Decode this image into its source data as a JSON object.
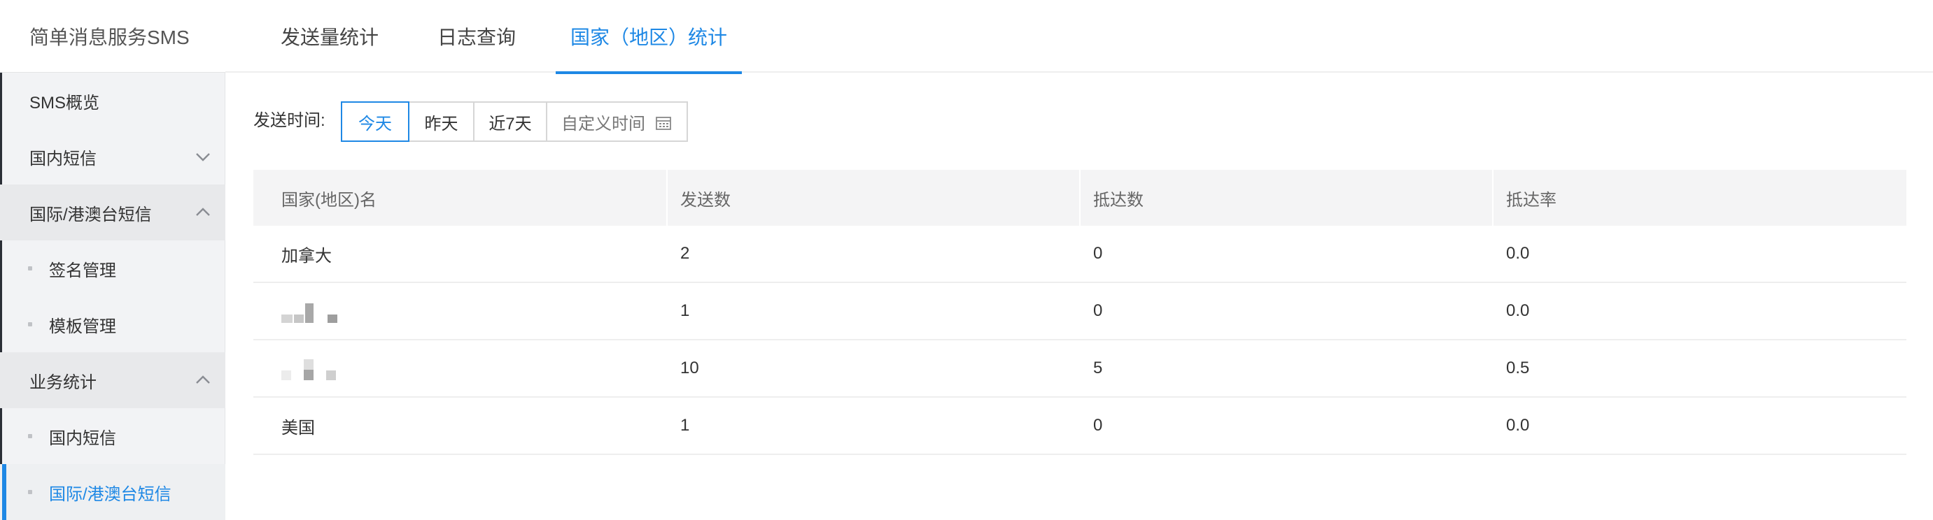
{
  "sidebar": {
    "title": "简单消息服务SMS",
    "items": [
      {
        "label": "SMS概览"
      },
      {
        "label": "国内短信",
        "chevron": "chevron-down-icon"
      },
      {
        "label": "国际/港澳台短信",
        "chevron": "chevron-up-icon"
      },
      {
        "label": "签名管理"
      },
      {
        "label": "模板管理"
      },
      {
        "label": "业务统计",
        "chevron": "chevron-up-icon"
      },
      {
        "label": "国内短信"
      },
      {
        "label": "国际/港澳台短信"
      }
    ]
  },
  "tabs": [
    {
      "label": "发送量统计"
    },
    {
      "label": "日志查询"
    },
    {
      "label": "国家（地区）统计"
    }
  ],
  "filter": {
    "label": "发送时间:",
    "options": [
      {
        "label": "今天"
      },
      {
        "label": "昨天"
      },
      {
        "label": "近7天"
      },
      {
        "label": "自定义时间",
        "icon": "calendar-icon"
      }
    ]
  },
  "table": {
    "columns": [
      "国家(地区)名",
      "发送数",
      "抵达数",
      "抵达率"
    ],
    "rows": [
      {
        "name": "加拿大",
        "sent": "2",
        "arrived": "0",
        "rate": "0.0"
      },
      {
        "name": "",
        "sent": "1",
        "arrived": "0",
        "rate": "0.0"
      },
      {
        "name": "",
        "sent": "10",
        "arrived": "5",
        "rate": "0.5"
      },
      {
        "name": "美国",
        "sent": "1",
        "arrived": "0",
        "rate": "0.0"
      }
    ]
  },
  "colors": {
    "accent": "#1e88e5",
    "sidebar_bg": "#f2f3f5",
    "header_bg": "#f4f4f5"
  }
}
